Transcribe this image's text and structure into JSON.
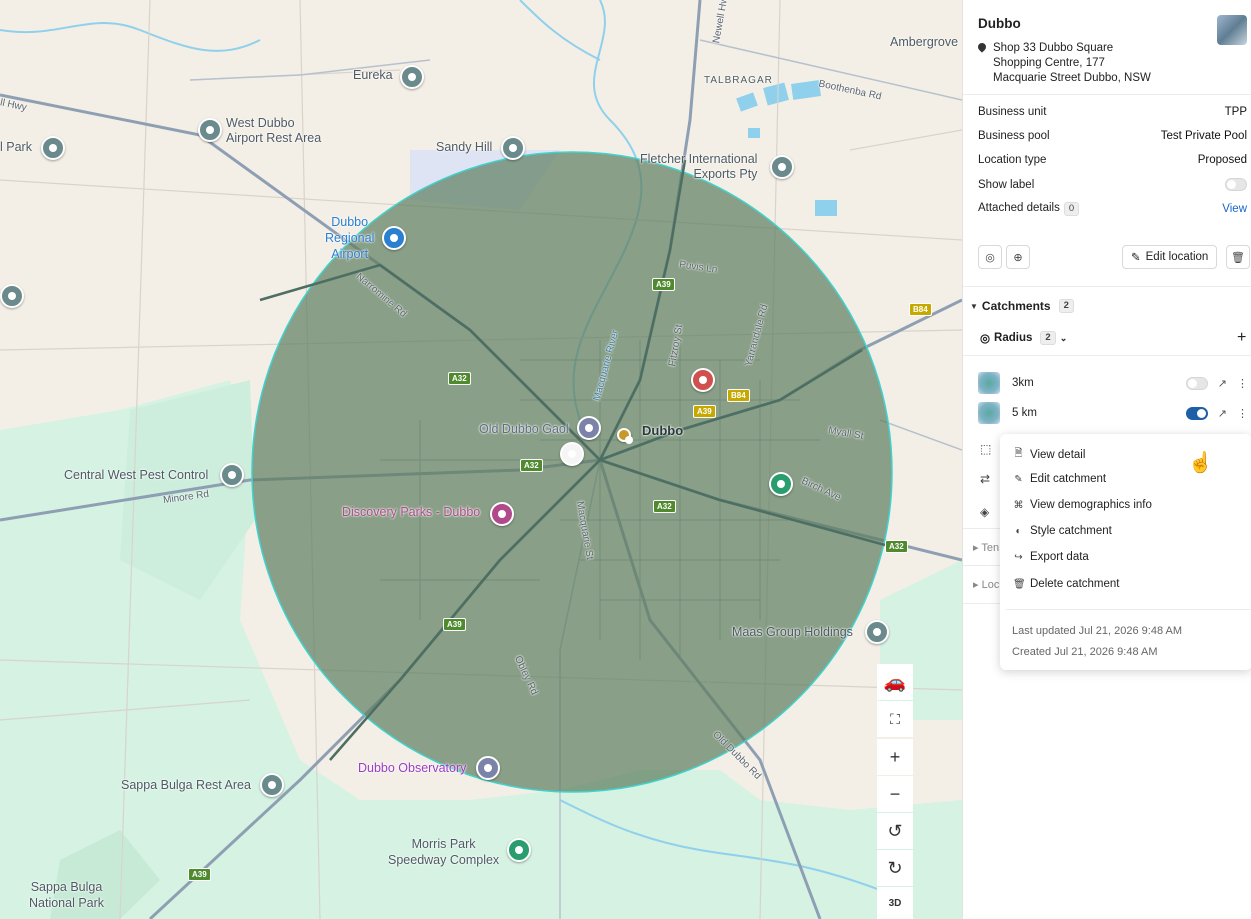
{
  "map": {
    "labels": [
      {
        "text": "Eureka",
        "name": "label-eureka"
      },
      {
        "text": "West Dubbo\nAirport Rest Area",
        "name": "label-west-dubbo-airport"
      },
      {
        "text": "Sandy Hill",
        "name": "label-sandy-hill"
      },
      {
        "text": "Fletcher International\nExports Pty",
        "name": "label-fletcher"
      },
      {
        "text": "Ambergrove",
        "name": "label-ambergrove"
      },
      {
        "text": "TALBRAGAR",
        "name": "label-talbragar"
      },
      {
        "text": "l Park",
        "name": "label-park-left"
      },
      {
        "text": "Dubbo\nRegional\nAirport",
        "name": "label-dubbo-airport"
      },
      {
        "text": "Old Dubbo Gaol",
        "name": "label-old-dubbo-gaol"
      },
      {
        "text": "Dubbo",
        "name": "label-dubbo"
      },
      {
        "text": "Central West Pest Control",
        "name": "label-central-west-pest"
      },
      {
        "text": "Discovery Parks - Dubbo",
        "name": "label-discovery-parks"
      },
      {
        "text": "Maas Group Holdings",
        "name": "label-maas-group"
      },
      {
        "text": "Dubbo Observatory",
        "name": "label-dubbo-observatory"
      },
      {
        "text": "Sappa Bulga Rest Area",
        "name": "label-sappa-bulga-rest"
      },
      {
        "text": "Morris Park\nSpeedway Complex",
        "name": "label-morris-park"
      },
      {
        "text": "Sappa Bulga\nNational Park",
        "name": "label-sappa-bulga-np"
      }
    ],
    "roads": [
      "Newell Hwy",
      "Boothenba Rd",
      "Narromine Rd",
      "Puvis Ln",
      "Fitzroy St",
      "Yarrandale Rd",
      "Myall St",
      "Birch Ave",
      "Minore Rd",
      "Macquarie St",
      "Obley Rd",
      "Old Dubbo Rd",
      "Macquarie River",
      "ll Hwy"
    ],
    "shields": [
      "A39",
      "A32",
      "B84",
      "A32",
      "A39",
      "B84",
      "A32",
      "A32",
      "A39",
      "A39"
    ],
    "controls": {
      "zoom_in": "+",
      "zoom_out": "−",
      "three_d": "3D"
    },
    "colors": {
      "catchment_fill": "#5f7f63",
      "catchment_stroke": "#3fd3d0",
      "park": "#d5f2e3",
      "land": "#f3efe6",
      "water": "#8fd0ec",
      "road": "#8f9fb3"
    }
  },
  "panel": {
    "title": "Dubbo",
    "address": [
      "Shop 33 Dubbo Square",
      "Shopping Centre, 177",
      "Macquarie Street Dubbo, NSW"
    ],
    "props": [
      {
        "label": "Business unit",
        "value": "TPP"
      },
      {
        "label": "Business pool",
        "value": "Test Private Pool"
      },
      {
        "label": "Location type",
        "value": "Proposed"
      }
    ],
    "show_label": "Show label",
    "attached_details": "Attached details",
    "attached_count": "0",
    "view_link": "View",
    "edit_location": "Edit location",
    "catchments_label": "Catchments",
    "catchments_count": "2",
    "radius_label": "Radius",
    "radius_count": "2",
    "add": "+",
    "catchments": [
      {
        "name": "3km",
        "enabled": false
      },
      {
        "name": "5 km",
        "enabled": true
      }
    ],
    "collapsed_sections": [
      "Ten",
      "Loc"
    ],
    "menu": {
      "items": [
        {
          "label": "View detail",
          "icon": "document-icon"
        },
        {
          "label": "Edit catchment",
          "icon": "pencil-icon"
        },
        {
          "label": "View demographics info",
          "icon": "scan-icon"
        },
        {
          "label": "Style catchment",
          "icon": "palette-icon"
        },
        {
          "label": "Export data",
          "icon": "export-icon"
        },
        {
          "label": "Delete catchment",
          "icon": "trash-icon"
        }
      ],
      "last_updated": "Last updated Jul 21, 2026 9:48 AM",
      "created": "Created Jul 21, 2026 9:48 AM"
    }
  }
}
